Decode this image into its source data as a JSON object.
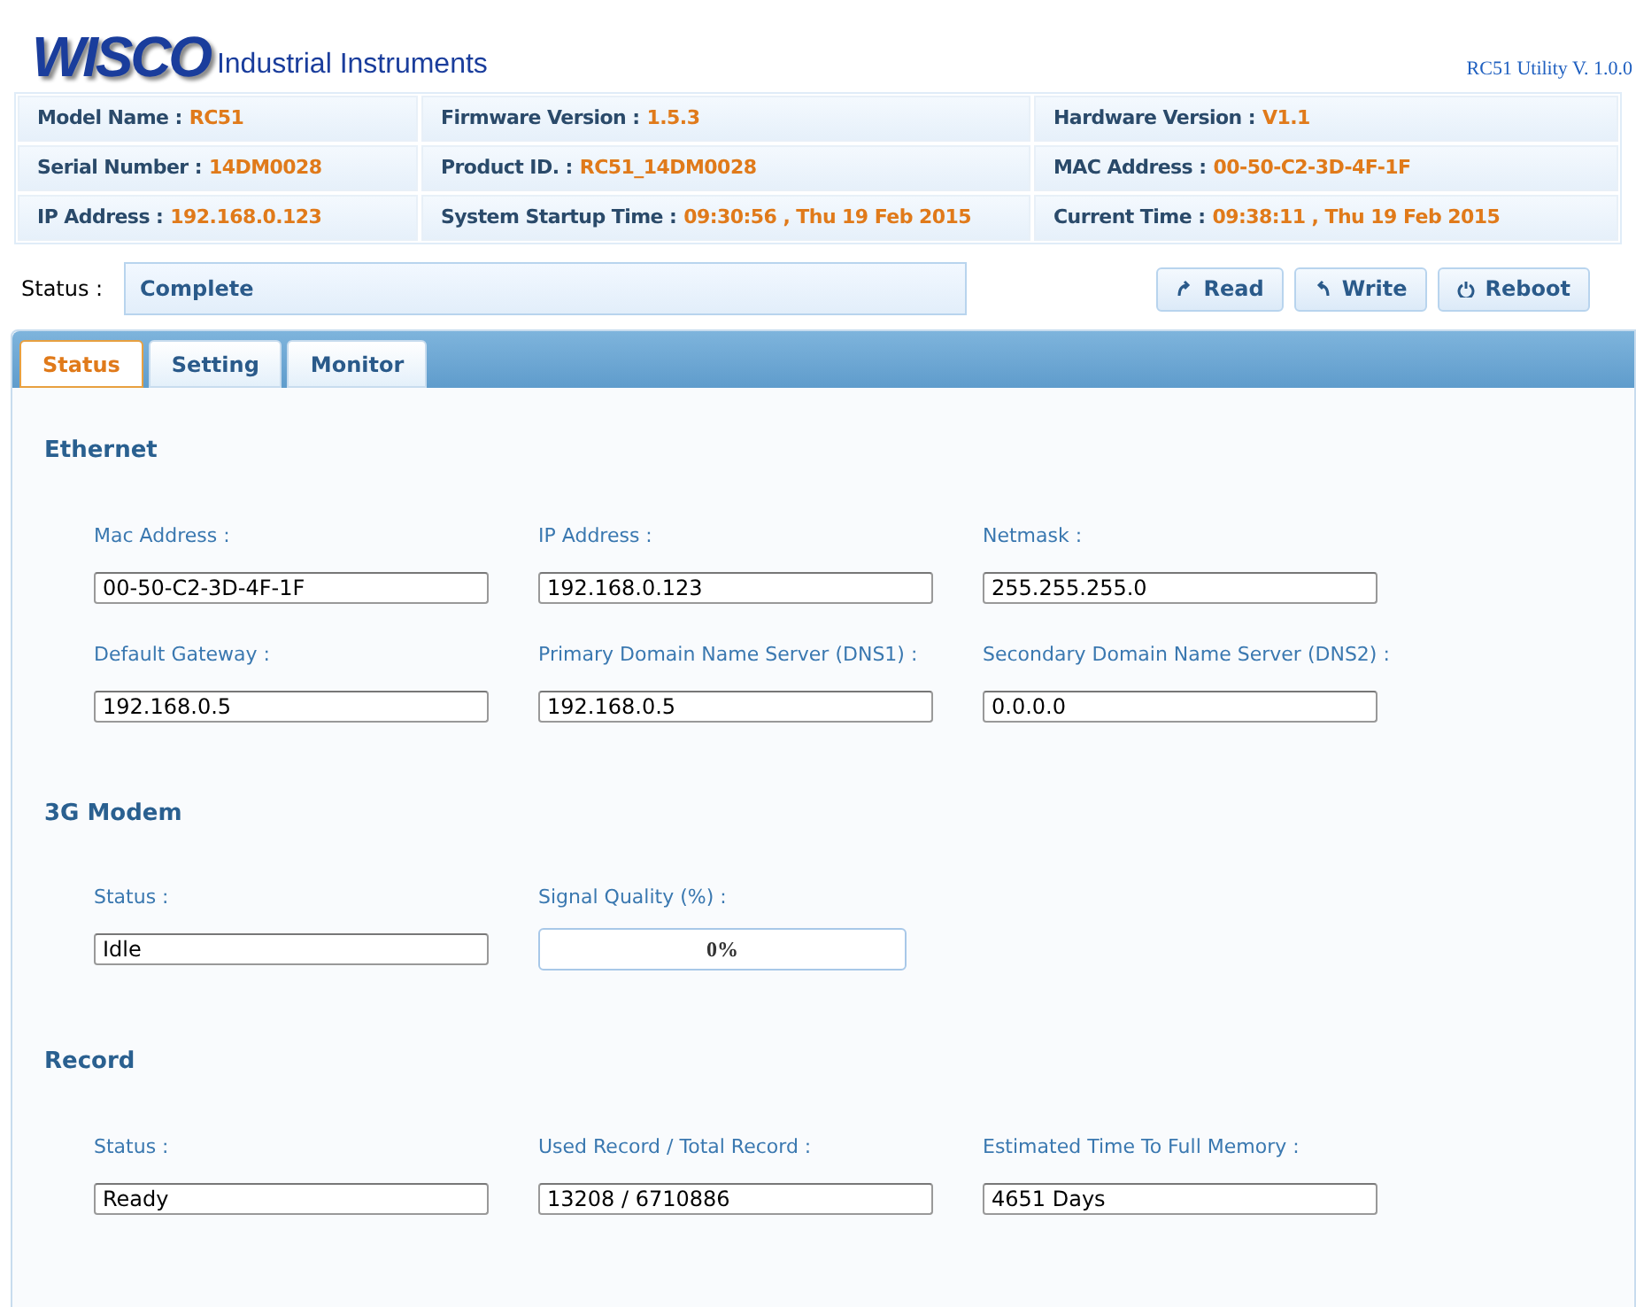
{
  "header": {
    "logo": "WISCO",
    "logo_tagline": "Industrial Instruments",
    "version": "RC51 Utility V. 1.0.0"
  },
  "info": [
    {
      "label": "Model Name :",
      "value": "RC51"
    },
    {
      "label": "Firmware Version :",
      "value": "1.5.3"
    },
    {
      "label": "Hardware Version :",
      "value": "V1.1"
    },
    {
      "label": "Serial Number :",
      "value": "14DM0028"
    },
    {
      "label": "Product ID. :",
      "value": "RC51_14DM0028"
    },
    {
      "label": "MAC Address :",
      "value": "00-50-C2-3D-4F-1F"
    },
    {
      "label": "IP Address :",
      "value": "192.168.0.123"
    },
    {
      "label": "System Startup Time :",
      "value": "09:30:56 , Thu 19 Feb 2015"
    },
    {
      "label": "Current Time :",
      "value": "09:38:11 , Thu 19 Feb 2015"
    }
  ],
  "status": {
    "label": "Status :",
    "value": "Complete"
  },
  "buttons": [
    {
      "label": "Read",
      "kind": "read"
    },
    {
      "label": "Write",
      "kind": "write"
    },
    {
      "label": "Reboot",
      "kind": "reboot"
    }
  ],
  "tabs": [
    {
      "label": "Status",
      "selected": true
    },
    {
      "label": "Setting",
      "selected": false
    },
    {
      "label": "Monitor",
      "selected": false
    }
  ],
  "sections": [
    {
      "title": "Ethernet",
      "fields": [
        {
          "kind": "text",
          "label": "Mac Address :",
          "value": "00-50-C2-3D-4F-1F"
        },
        {
          "kind": "text",
          "label": "IP Address :",
          "value": "192.168.0.123"
        },
        {
          "kind": "text",
          "label": "Netmask :",
          "value": "255.255.255.0"
        },
        {
          "kind": "text",
          "label": "Default Gateway :",
          "value": "192.168.0.5"
        },
        {
          "kind": "text",
          "label": "Primary Domain Name Server (DNS1) :",
          "value": "192.168.0.5"
        },
        {
          "kind": "text",
          "label": "Secondary Domain Name Server (DNS2) :",
          "value": "0.0.0.0"
        }
      ]
    },
    {
      "title": "3G Modem",
      "fields": [
        {
          "kind": "text",
          "label": "Status :",
          "value": "Idle"
        },
        {
          "kind": "meter",
          "label": "Signal Quality (%) :",
          "level": 0,
          "reading": "0%"
        }
      ]
    },
    {
      "title": "Record",
      "fields": [
        {
          "kind": "text",
          "label": "Status :",
          "value": "Ready"
        },
        {
          "kind": "text",
          "label": "Used Record / Total Record :",
          "value": "13208 / 6710886"
        },
        {
          "kind": "text",
          "label": "Estimated Time To Full Memory :",
          "value": "4651 Days"
        }
      ]
    }
  ]
}
